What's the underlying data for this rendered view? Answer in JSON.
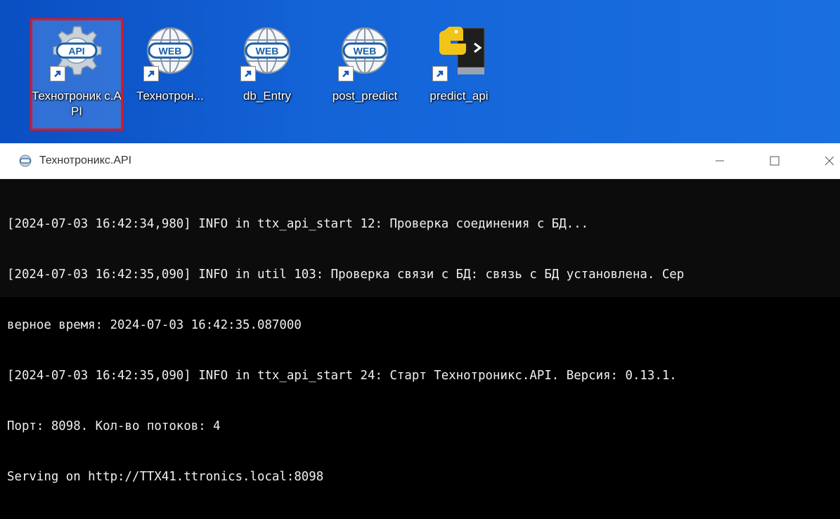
{
  "desktop": {
    "icons": [
      {
        "label": "Технотроник с.API",
        "badge": "API",
        "type": "api-gear",
        "selected": true
      },
      {
        "label": "Технотрон...",
        "badge": "WEB",
        "type": "web-globe",
        "selected": false
      },
      {
        "label": "db_Entry",
        "badge": "WEB",
        "type": "web-globe",
        "selected": false
      },
      {
        "label": "post_predict",
        "badge": "WEB",
        "type": "web-globe",
        "selected": false
      },
      {
        "label": "predict_api",
        "badge": "",
        "type": "python-console",
        "selected": false
      }
    ],
    "selection_color": "#e0161b"
  },
  "window": {
    "title": "Технотроникс.API",
    "console_lines": [
      "[2024-07-03 16:42:34,980] INFO in ttx_api_start 12: Проверка соединения с БД...",
      "[2024-07-03 16:42:35,090] INFO in util 103: Проверка связи с БД: связь с БД установлена. Сер",
      "верное время: 2024-07-03 16:42:35.087000",
      "[2024-07-03 16:42:35,090] INFO in ttx_api_start 24: Старт Технотроникс.API. Версия: 0.13.1.",
      "Порт: 8098. Кол-во потоков: 4",
      "Serving on http://TTX41.ttronics.local:8098"
    ],
    "controls": [
      "minimize",
      "maximize",
      "close"
    ]
  }
}
